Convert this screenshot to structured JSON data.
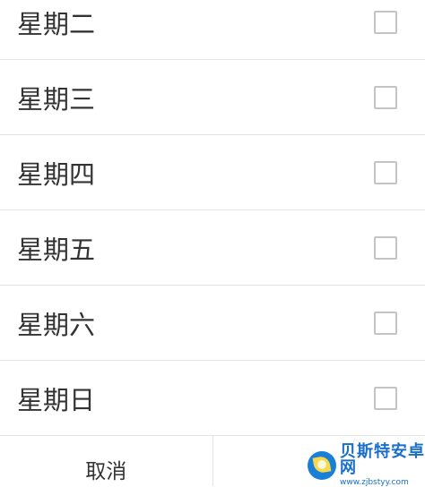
{
  "days": [
    {
      "label": "星期二",
      "checked": false
    },
    {
      "label": "星期三",
      "checked": false
    },
    {
      "label": "星期四",
      "checked": false
    },
    {
      "label": "星期五",
      "checked": false
    },
    {
      "label": "星期六",
      "checked": false
    },
    {
      "label": "星期日",
      "checked": false
    }
  ],
  "footer": {
    "cancel_label": "取消",
    "confirm_label": ""
  },
  "watermark": {
    "name": "贝斯特安卓网",
    "url": "www.zjbstyy.com",
    "icon": "leaf-logo-icon"
  },
  "colors": {
    "text": "#333333",
    "divider": "#e4e4e4",
    "checkbox_border": "#c4c4c4",
    "watermark_blue": "#1a7fd6"
  }
}
